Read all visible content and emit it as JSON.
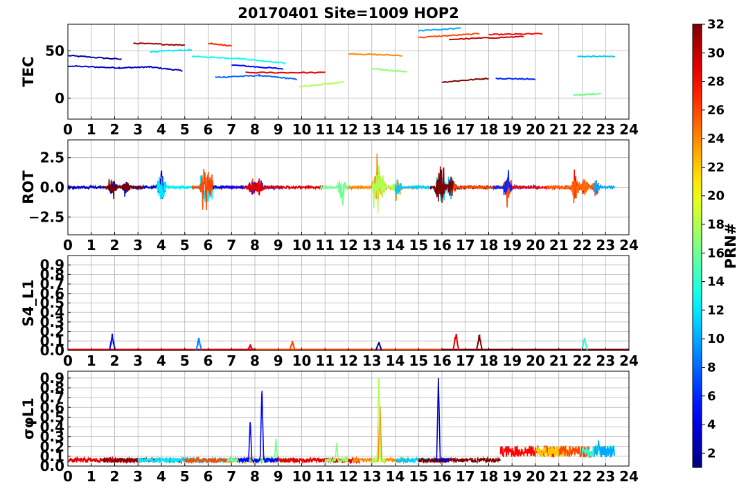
{
  "figure": {
    "title": "20170401 Site=1009 HOP2"
  },
  "chart_data": [
    {
      "type": "line",
      "ylabel": "TEC",
      "xlim": [
        0,
        24
      ],
      "ylim": [
        -22,
        78
      ],
      "xticks": [
        "0",
        "1",
        "2",
        "3",
        "4",
        "5",
        "6",
        "7",
        "8",
        "9",
        "10",
        "11",
        "12",
        "13",
        "14",
        "15",
        "16",
        "17",
        "18",
        "19",
        "20",
        "21",
        "22",
        "23",
        "24"
      ],
      "yticks": [
        {
          "v": 0,
          "label": "0"
        },
        {
          "v": 50,
          "label": "50"
        }
      ],
      "grid": true,
      "series": [
        {
          "prn": 2,
          "x": [
            0.0,
            2.3
          ],
          "y": [
            45,
            41
          ]
        },
        {
          "prn": 3,
          "x": [
            0.0,
            2.2,
            3.5,
            4.9
          ],
          "y": [
            34,
            32,
            33,
            29
          ]
        },
        {
          "prn": 5,
          "x": [
            7.0,
            9.2
          ],
          "y": [
            35,
            31
          ]
        },
        {
          "prn": 6,
          "x": [
            18.3,
            20.0
          ],
          "y": [
            21,
            20
          ]
        },
        {
          "prn": 8,
          "x": [
            6.3,
            8.2,
            9.8
          ],
          "y": [
            22,
            24,
            20
          ]
        },
        {
          "prn": 10,
          "x": [
            15.0,
            16.8
          ],
          "y": [
            71,
            74
          ]
        },
        {
          "prn": 11,
          "x": [
            21.8,
            23.4
          ],
          "y": [
            44,
            44
          ]
        },
        {
          "prn": 12,
          "x": [
            3.5,
            5.3
          ],
          "y": [
            49,
            51
          ]
        },
        {
          "prn": 13,
          "x": [
            5.3,
            7.3,
            9.3
          ],
          "y": [
            44,
            42,
            37
          ]
        },
        {
          "prn": 18,
          "x": [
            9.9,
            11.8
          ],
          "y": [
            12,
            17
          ]
        },
        {
          "prn": 17,
          "x": [
            13.0,
            14.5
          ],
          "y": [
            31,
            28
          ]
        },
        {
          "prn": 16,
          "x": [
            21.6,
            22.8
          ],
          "y": [
            3,
            5
          ]
        },
        {
          "prn": 24,
          "x": [
            12.0,
            14.3
          ],
          "y": [
            47,
            45
          ]
        },
        {
          "prn": 26,
          "x": [
            15.0,
            17.6
          ],
          "y": [
            64,
            68
          ]
        },
        {
          "prn": 27,
          "x": [
            6.0,
            7.0
          ],
          "y": [
            58,
            55
          ]
        },
        {
          "prn": 28,
          "x": [
            18.0,
            20.3
          ],
          "y": [
            67,
            68
          ]
        },
        {
          "prn": 29,
          "x": [
            7.6,
            11.0
          ],
          "y": [
            27,
            27
          ]
        },
        {
          "prn": 30,
          "x": [
            16.3,
            19.5
          ],
          "y": [
            62,
            65
          ]
        },
        {
          "prn": 31,
          "x": [
            2.8,
            5.0
          ],
          "y": [
            58,
            56
          ]
        },
        {
          "prn": 32,
          "x": [
            16.0,
            18.0
          ],
          "y": [
            17,
            21
          ]
        }
      ]
    },
    {
      "type": "line",
      "ylabel": "ROT",
      "xlim": [
        0,
        24
      ],
      "ylim": [
        -4,
        4
      ],
      "xticks": [
        "0",
        "1",
        "2",
        "3",
        "4",
        "5",
        "6",
        "7",
        "8",
        "9",
        "10",
        "11",
        "12",
        "13",
        "14",
        "15",
        "16",
        "17",
        "18",
        "19",
        "20",
        "21",
        "22",
        "23",
        "24"
      ],
      "yticks": [
        {
          "v": -2.5,
          "label": "−2.5"
        },
        {
          "v": 0,
          "label": "0.0"
        },
        {
          "v": 2.5,
          "label": "2.5"
        }
      ],
      "grid": true
    },
    {
      "type": "line",
      "ylabel": "S4_L1",
      "xlim": [
        0,
        24
      ],
      "ylim": [
        0,
        1.0
      ],
      "xticks": [
        "0",
        "1",
        "2",
        "3",
        "4",
        "5",
        "6",
        "7",
        "8",
        "9",
        "10",
        "11",
        "12",
        "13",
        "14",
        "15",
        "16",
        "17",
        "18",
        "19",
        "20",
        "21",
        "22",
        "23",
        "24"
      ],
      "yticks": [
        {
          "v": 0.0,
          "label": "0.0"
        },
        {
          "v": 0.1,
          "label": "0.1"
        },
        {
          "v": 0.2,
          "label": "0.2"
        },
        {
          "v": 0.3,
          "label": "0.3"
        },
        {
          "v": 0.4,
          "label": "0.4"
        },
        {
          "v": 0.5,
          "label": "0.5"
        },
        {
          "v": 0.6,
          "label": "0.6"
        },
        {
          "v": 0.7,
          "label": "0.7"
        },
        {
          "v": 0.8,
          "label": "0.8"
        },
        {
          "v": 0.9,
          "label": "0.9"
        }
      ],
      "grid": true,
      "peaks": [
        {
          "x": 1.9,
          "y": 0.18,
          "prn": 5
        },
        {
          "x": 5.6,
          "y": 0.14,
          "prn": 9
        },
        {
          "x": 7.8,
          "y": 0.06,
          "prn": 29
        },
        {
          "x": 9.6,
          "y": 0.1,
          "prn": 26
        },
        {
          "x": 13.3,
          "y": 0.1,
          "prn": 2
        },
        {
          "x": 16.6,
          "y": 0.2,
          "prn": 29
        },
        {
          "x": 17.6,
          "y": 0.18,
          "prn": 32
        },
        {
          "x": 22.1,
          "y": 0.15,
          "prn": 14
        }
      ]
    },
    {
      "type": "line",
      "ylabel": "σφL1",
      "xlim": [
        0,
        24
      ],
      "ylim": [
        0,
        0.97
      ],
      "xticks": [
        "0",
        "1",
        "2",
        "3",
        "4",
        "5",
        "6",
        "7",
        "8",
        "9",
        "10",
        "11",
        "12",
        "13",
        "14",
        "15",
        "16",
        "17",
        "18",
        "19",
        "20",
        "21",
        "22",
        "23",
        "24"
      ],
      "yticks": [
        {
          "v": 0.0,
          "label": "0.0"
        },
        {
          "v": 0.1,
          "label": "0.1"
        },
        {
          "v": 0.2,
          "label": "0.2"
        },
        {
          "v": 0.3,
          "label": "0.3"
        },
        {
          "v": 0.4,
          "label": "0.4"
        },
        {
          "v": 0.5,
          "label": "0.5"
        },
        {
          "v": 0.6,
          "label": "0.6"
        },
        {
          "v": 0.7,
          "label": "0.7"
        },
        {
          "v": 0.8,
          "label": "0.8"
        },
        {
          "v": 0.9,
          "label": "0.9"
        }
      ],
      "grid": true,
      "peaks": [
        {
          "x": 7.8,
          "y": 0.48,
          "prn": 5
        },
        {
          "x": 8.3,
          "y": 0.82,
          "prn": 5
        },
        {
          "x": 13.3,
          "y": 0.9,
          "prn": 18
        },
        {
          "x": 13.35,
          "y": 0.65,
          "prn": 24
        },
        {
          "x": 15.85,
          "y": 0.9,
          "prn": 3
        },
        {
          "x": 16.0,
          "y": 0.8,
          "prn": 5
        },
        {
          "x": 11.5,
          "y": 0.25,
          "prn": 17
        },
        {
          "x": 8.9,
          "y": 0.28,
          "prn": 16
        },
        {
          "x": 22.7,
          "y": 0.28,
          "prn": 10
        }
      ]
    }
  ],
  "colorbar": {
    "label": "PRN#",
    "range": [
      1,
      32
    ],
    "ticks": [
      "2",
      "4",
      "6",
      "8",
      "10",
      "12",
      "14",
      "16",
      "18",
      "20",
      "22",
      "24",
      "26",
      "28",
      "30",
      "32"
    ]
  }
}
